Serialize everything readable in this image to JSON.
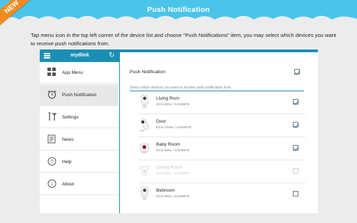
{
  "header": {
    "title": "Push Notification",
    "ribbon": "NEW",
    "color": "#4bc4ea"
  },
  "intro": "Tap menu icon in the top left corner of the device list and choose \"Push Notifications\" item, you may select which devices you want to receive push notifications from.",
  "app": {
    "title": "mydlink",
    "menu_icon": "hamburger-icon",
    "refresh_icon": "refresh-icon",
    "accent": "#1a8fb5"
  },
  "sidebar": {
    "items": [
      {
        "label": "App Menu",
        "icon": "grid-icon",
        "active": false
      },
      {
        "label": "Push Notification",
        "icon": "alarm-clock-icon",
        "active": true
      },
      {
        "label": "Settings",
        "icon": "tools-icon",
        "active": false
      },
      {
        "label": "News",
        "icon": "news-icon",
        "active": false
      },
      {
        "label": "Help",
        "icon": "help-icon",
        "active": false
      },
      {
        "label": "About",
        "icon": "info-icon",
        "active": false
      }
    ]
  },
  "panel": {
    "push_label": "Push Notification",
    "push_enabled": true,
    "select_hint": "Select which devices you want to receive push notification from",
    "devices": [
      {
        "name": "Living Rom",
        "model": "DCS-932L / 12345678",
        "checked": true,
        "enabled": true
      },
      {
        "name": "Door",
        "model": "DCS-7010L / 12345678",
        "checked": true,
        "enabled": true
      },
      {
        "name": "Baby Room",
        "model": "DCS-825L / 12345678",
        "checked": true,
        "enabled": true
      },
      {
        "name": "Dining Room",
        "model": "DCS-825L / 12345678",
        "checked": false,
        "enabled": false
      },
      {
        "name": "Bebroom",
        "model": "DCS-932L / 12345678",
        "checked": false,
        "enabled": true
      }
    ]
  }
}
